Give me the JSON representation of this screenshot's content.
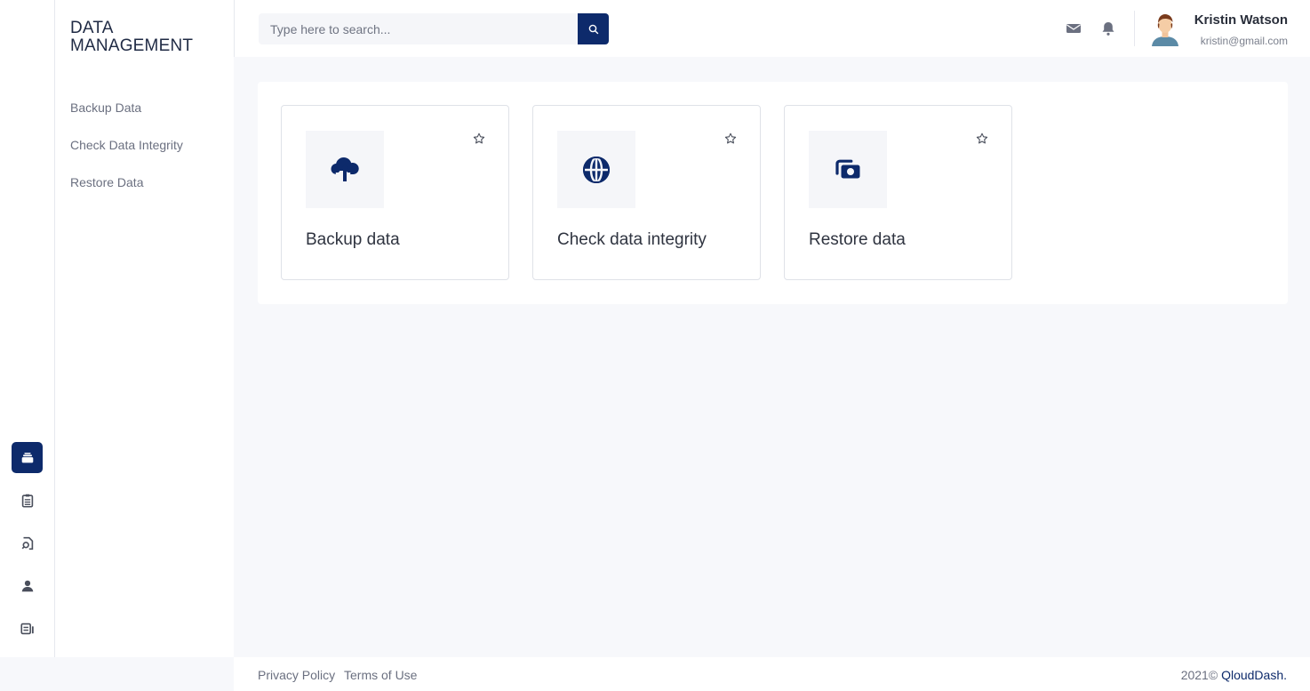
{
  "brand": {
    "title": "DATA MANAGEMENT"
  },
  "sidebar": {
    "items": [
      {
        "label": "Backup Data"
      },
      {
        "label": "Check Data Integrity"
      },
      {
        "label": "Restore Data"
      }
    ]
  },
  "rail": {
    "items": [
      {
        "icon": "database-icon",
        "active": true
      },
      {
        "icon": "clipboard-list-icon",
        "active": false
      },
      {
        "icon": "file-search-icon",
        "active": false
      },
      {
        "icon": "user-icon",
        "active": false
      },
      {
        "icon": "report-icon",
        "active": false
      }
    ]
  },
  "search": {
    "placeholder": "Type here to search...",
    "value": ""
  },
  "header": {
    "icons": [
      "mail-icon",
      "bell-icon"
    ],
    "user": {
      "name": "Kristin Watson",
      "email": "kristin@gmail.com"
    }
  },
  "cards": [
    {
      "title": "Backup data",
      "icon": "cloud-upload-icon"
    },
    {
      "title": "Check data integrity",
      "icon": "globe-icon"
    },
    {
      "title": "Restore data",
      "icon": "restore-stack-icon"
    }
  ],
  "footer": {
    "privacy": "Privacy Policy",
    "terms": "Terms of Use",
    "copyright": "2021©",
    "company": "QloudDash",
    "period": "."
  },
  "colors": {
    "accent": "#0d2a6b",
    "background": "#f7f8fb",
    "text": "#3a3f4b"
  }
}
